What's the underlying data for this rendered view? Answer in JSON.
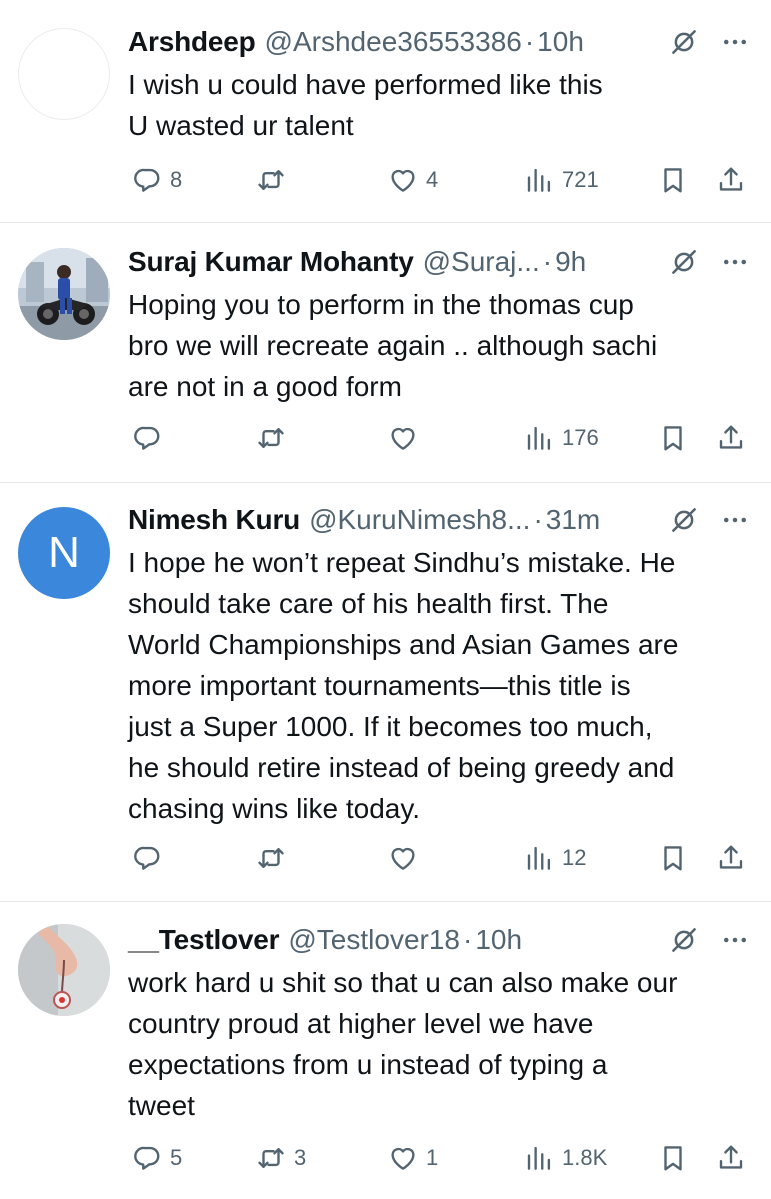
{
  "tweets": [
    {
      "name": "Arshdeep",
      "handle": "@Arshdee36553386",
      "time": "10h",
      "avatar": "blank",
      "lines": [
        "I wish u could have performed like this",
        "U wasted ur talent"
      ],
      "replies": "8",
      "retweets": "",
      "likes": "4",
      "views": "721"
    },
    {
      "name": "Suraj Kumar Mohanty",
      "handle": "@Suraj...",
      "time": "9h",
      "avatar": "photo-motorcycle",
      "lines": [
        "Hoping you to perform in the thomas cup",
        "bro we will recreate again .. although sachi",
        "are not in a good form"
      ],
      "replies": "",
      "retweets": "",
      "likes": "",
      "views": "176"
    },
    {
      "name": "Nimesh Kuru",
      "handle": "@KuruNimesh8...",
      "time": "31m",
      "avatar": "letter",
      "avatar_letter": "N",
      "avatar_color": "#3a87db",
      "lines": [
        "I hope he won’t repeat Sindhu’s mistake. He",
        "should take care of his health first. The",
        "World Championships and Asian Games are",
        "more important tournaments—this title is",
        "just a Super 1000. If it becomes too much,",
        "he should retire instead of being greedy and",
        "chasing wins like today."
      ],
      "replies": "",
      "retweets": "",
      "likes": "",
      "views": "12"
    },
    {
      "name": "__Testlover",
      "handle": "@Testlover18",
      "time": "10h",
      "avatar": "photo-hand",
      "lines": [
        "work hard u shit so that u can also make our",
        "country proud at higher level we have",
        "expectations from u instead of typing a",
        "tweet"
      ],
      "replies": "5",
      "retweets": "3",
      "likes": "1",
      "views": "1.8K"
    }
  ],
  "icons": {
    "reply": "reply-icon",
    "retweet": "retweet-icon",
    "like": "heart-icon",
    "views": "views-icon",
    "bookmark": "bookmark-icon",
    "share": "share-icon",
    "mute": "mute-icon",
    "more": "more-icon"
  },
  "colors": {
    "text": "#0f1419",
    "secondary": "#536471",
    "divider": "#e4e7ea"
  }
}
